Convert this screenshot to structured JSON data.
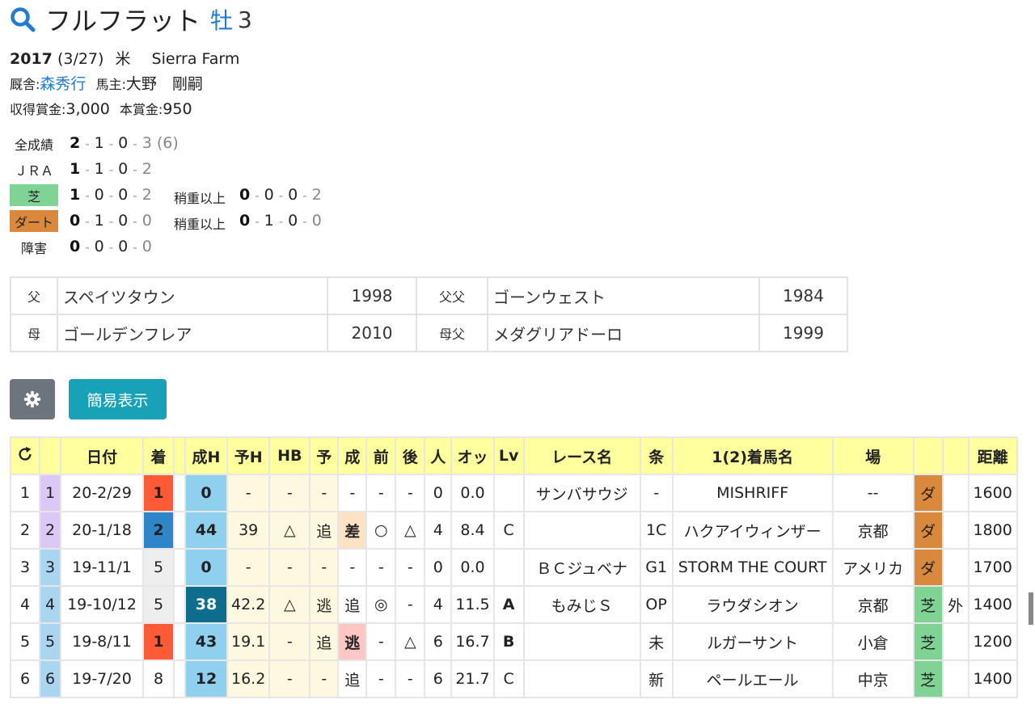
{
  "horse": {
    "name": "フルフラット",
    "sex": "牡",
    "age": "3",
    "birth_year": "2017",
    "birth_date": "(3/27)",
    "country": "米",
    "breeder": "Sierra Farm",
    "stable_label": "厩舎:",
    "trainer": "森秀行",
    "owner_label": "馬主:",
    "owner": "大野　剛嗣",
    "prize_label": "収得賞金:",
    "prize": "3,000",
    "main_prize_label": "本賞金:",
    "main_prize": "950"
  },
  "records": {
    "all": {
      "label": "全成績",
      "w": "2",
      "s": "1",
      "t": "0",
      "o": "3",
      "extra": "(6)"
    },
    "jra": {
      "label": "ＪＲＡ",
      "w": "1",
      "s": "1",
      "t": "0",
      "o": "2"
    },
    "turf": {
      "label": "芝",
      "w": "1",
      "s": "0",
      "t": "0",
      "o": "2",
      "heavy_label": "稍重以上",
      "hw": "0",
      "hs": "0",
      "ht": "0",
      "ho": "2"
    },
    "dirt": {
      "label": "ダート",
      "w": "0",
      "s": "1",
      "t": "0",
      "o": "0",
      "heavy_label": "稍重以上",
      "hw": "0",
      "hs": "1",
      "ht": "0",
      "ho": "0"
    },
    "jump": {
      "label": "障害",
      "w": "0",
      "s": "0",
      "t": "0",
      "o": "0"
    }
  },
  "pedigree": {
    "sire_label": "父",
    "sire": "スペイツタウン",
    "sire_year": "1998",
    "sire_sire_label": "父父",
    "sire_sire": "ゴーンウェスト",
    "sire_sire_year": "1984",
    "dam_label": "母",
    "dam": "ゴールデンフレア",
    "dam_year": "2010",
    "dam_sire_label": "母父",
    "dam_sire": "メダグリアドーロ",
    "dam_sire_year": "1999"
  },
  "buttons": {
    "simple_view": "簡易表示"
  },
  "table": {
    "headers": [
      "",
      "",
      "日付",
      "着",
      "",
      "成H",
      "予H",
      "HB",
      "予",
      "成",
      "前",
      "後",
      "人",
      "オッ",
      "Lv",
      "レース名",
      "条",
      "1(2)着馬名",
      "場",
      "",
      "",
      "距離"
    ],
    "rows": [
      [
        "1",
        "1",
        "20-2/29",
        "1",
        "",
        "0",
        "-",
        "-",
        "-",
        "-",
        "-",
        "-",
        "0",
        "0.0",
        "",
        "サンバサウジ",
        "-",
        "MISHRIFF",
        "--",
        "ダ",
        "",
        "1600"
      ],
      [
        "2",
        "2",
        "20-1/18",
        "2",
        "",
        "44",
        "39",
        "△",
        "追",
        "差",
        "○",
        "△",
        "4",
        "8.4",
        "C",
        "",
        "1C",
        "ハクアイウィンザー",
        "京都",
        "ダ",
        "",
        "1800"
      ],
      [
        "3",
        "3",
        "19-11/1",
        "5",
        "",
        "0",
        "-",
        "-",
        "-",
        "-",
        "-",
        "-",
        "0",
        "0.0",
        "",
        "ＢＣジュベナ",
        "G1",
        "STORM THE COURT",
        "アメリカ",
        "ダ",
        "",
        "1700"
      ],
      [
        "4",
        "4",
        "19-10/12",
        "5",
        "",
        "38",
        "42.2",
        "△",
        "逃",
        "追",
        "◎",
        "-",
        "4",
        "11.5",
        "A",
        "もみじＳ",
        "OP",
        "ラウダシオン",
        "京都",
        "芝",
        "外",
        "1400"
      ],
      [
        "5",
        "5",
        "19-8/11",
        "1",
        "",
        "43",
        "19.1",
        "-",
        "追",
        "逃",
        "-",
        "△",
        "6",
        "16.7",
        "B",
        "",
        "未",
        "ルガーサント",
        "小倉",
        "芝",
        "",
        "1200"
      ],
      [
        "6",
        "6",
        "19-7/20",
        "8",
        "",
        "12",
        "16.2",
        "-",
        "-",
        "追",
        "-",
        "-",
        "6",
        "21.7",
        "C",
        "",
        "新",
        "ペールエール",
        "中京",
        "芝",
        "",
        "1400"
      ]
    ]
  },
  "colors": {
    "turf": "#7fd395",
    "dirt": "#d9883c",
    "win": "#ff5a36",
    "second": "#2e86c8",
    "header": "#ffff9e",
    "accent": "#1e7bd6"
  },
  "icons": {
    "title": "search-icon",
    "settings": "gear-icon",
    "refresh": "refresh-icon"
  }
}
